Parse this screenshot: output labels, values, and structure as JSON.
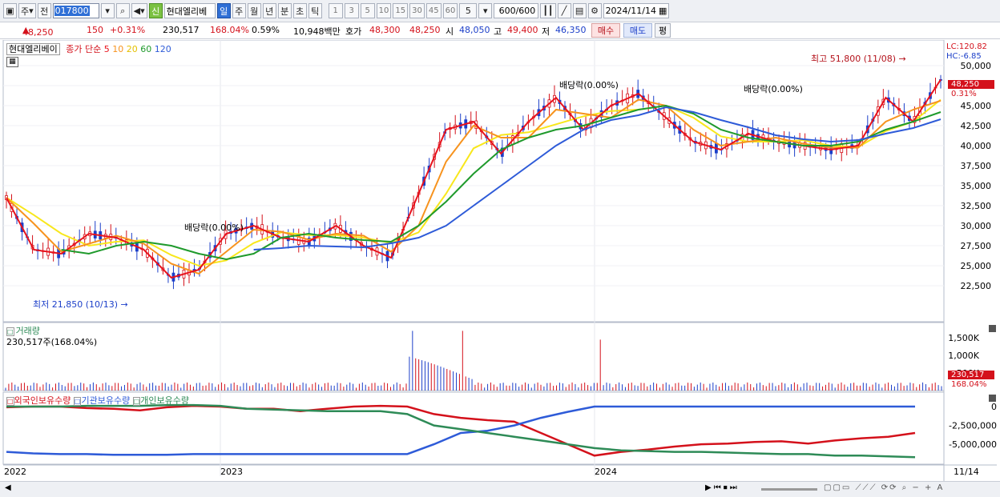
{
  "toolbar": {
    "period_label": "주",
    "prev_label": "전",
    "stock_code": "017800",
    "sin_label": "신",
    "stock_name": "현대엘리베",
    "tabs": [
      "일",
      "주",
      "월",
      "년",
      "분",
      "초",
      "틱"
    ],
    "selected_tab": "일",
    "intervals": [
      "1",
      "3",
      "5",
      "10",
      "15",
      "30",
      "45",
      "60"
    ],
    "interval_value": "5",
    "count": "600/600",
    "date": "2024/11/14"
  },
  "quote": {
    "price": "48,250",
    "change": "150",
    "change_pct": "+0.31%",
    "volume": "230,517",
    "volume_pct": "168.04%",
    "turnover_pct": "0.59%",
    "amount": "10,948백만",
    "ask_label": "호가",
    "ask": "48,300",
    "bid": "48,250",
    "open_label": "시",
    "open": "48,050",
    "high_label": "고",
    "high": "49,400",
    "low_label": "저",
    "low": "46,350",
    "buy_label": "매수",
    "sell_label": "매도",
    "eval_label": "평"
  },
  "price_panel": {
    "name_tag": "현대엘리베이",
    "ma_title": "종가 단순",
    "ma_periods": [
      "5",
      "10",
      "20",
      "60",
      "120"
    ],
    "lc": "LC:120.82",
    "hc": "HC:-6.85",
    "current_tag": "48,250",
    "current_pct": "0.31%",
    "high_note": "최고 51,800 (11/08)",
    "low_note": "최저 21,850 (10/13)",
    "dividend_notes": [
      "배당락(0.00%)",
      "배당락(0.00%)",
      "배당락(0.00%)"
    ]
  },
  "volume_panel": {
    "title": "거래량",
    "value": "230,517주(168.04%)",
    "tag_value": "230,517",
    "tag_pct": "168.04%"
  },
  "holding_panel": {
    "series_labels": [
      "외국인보유수량",
      "기관보유수량",
      "개인보유수량"
    ]
  },
  "x_axis": {
    "labels": [
      "2022",
      "2023",
      "2024"
    ],
    "end_label": "11/14"
  },
  "colors": {
    "up": "#d4111b",
    "down": "#1c3fc9",
    "ma5": "#e8121c",
    "ma10": "#f7931e",
    "ma20": "#f8e71c",
    "ma60": "#1f9a2c",
    "ma120": "#2e5bd8",
    "foreign": "#d4111b",
    "institution": "#2e5bd8",
    "individual": "#2e8b57"
  },
  "chart_data": [
    {
      "type": "line",
      "title": "현대엘리베이",
      "ylim": [
        20000,
        53000
      ],
      "y_ticks": [
        "50,000",
        "47,500",
        "45,000",
        "42,500",
        "40,000",
        "37,500",
        "35,000",
        "32,500",
        "30,000",
        "27,500",
        "25,000",
        "22,500"
      ],
      "x": [
        "2022-01",
        "2022-02",
        "2022-03",
        "2022-04",
        "2022-05",
        "2022-06",
        "2022-07",
        "2022-08",
        "2022-09",
        "2022-10",
        "2022-11",
        "2022-12",
        "2023-01",
        "2023-02",
        "2023-03",
        "2023-04",
        "2023-05",
        "2023-06",
        "2023-07",
        "2023-08",
        "2023-09",
        "2023-10",
        "2023-11",
        "2023-12",
        "2024-01",
        "2024-02",
        "2024-03",
        "2024-04",
        "2024-05",
        "2024-06",
        "2024-07",
        "2024-08",
        "2024-09",
        "2024-10",
        "2024-11"
      ],
      "series": [
        {
          "name": "5",
          "values": [
            33500,
            27000,
            26500,
            29000,
            28500,
            27000,
            23500,
            24500,
            29000,
            30000,
            28500,
            28000,
            30000,
            27500,
            26000,
            34000,
            42000,
            43000,
            39000,
            43000,
            46000,
            42000,
            45000,
            46500,
            43500,
            40500,
            39500,
            41500,
            40500,
            40000,
            39500,
            40000,
            46000,
            43000,
            48250
          ]
        },
        {
          "name": "60",
          "values": [
            null,
            null,
            27000,
            26500,
            27500,
            28000,
            27500,
            26500,
            25800,
            26500,
            28500,
            29000,
            28500,
            28200,
            28000,
            30000,
            33000,
            36500,
            39500,
            41000,
            42000,
            42500,
            43500,
            44500,
            45000,
            44000,
            42000,
            41000,
            40500,
            40000,
            40000,
            40500,
            42000,
            43000,
            44200
          ]
        },
        {
          "name": "120",
          "values": [
            null,
            null,
            null,
            null,
            null,
            null,
            null,
            null,
            null,
            27000,
            27200,
            27500,
            27400,
            27300,
            27800,
            28500,
            30000,
            32500,
            35000,
            37500,
            40000,
            42000,
            43200,
            43800,
            44800,
            44200,
            43200,
            42300,
            41300,
            40800,
            40500,
            40700,
            41500,
            42200,
            43300
          ]
        }
      ]
    },
    {
      "type": "bar",
      "title": "거래량",
      "ylim": [
        0,
        1800000
      ],
      "y_ticks": [
        "1,500K",
        "1,000K",
        "500K"
      ]
    },
    {
      "type": "line",
      "title": "보유수량",
      "ylim": [
        -7000000,
        1000000
      ],
      "y_ticks": [
        "0",
        "-2,500,000",
        "-5,000,000"
      ],
      "series": [
        {
          "name": "외국인보유수량",
          "values": [
            -100000,
            0,
            0,
            -200000,
            -300000,
            -500000,
            -100000,
            100000,
            0,
            -300000,
            -300000,
            -600000,
            -300000,
            0,
            100000,
            0,
            -1000000,
            -1500000,
            -1800000,
            -2000000,
            -3500000,
            -5000000,
            -6500000,
            -6000000,
            -5700000,
            -5300000,
            -5000000,
            -4900000,
            -4700000,
            -4600000,
            -4900000,
            -4500000,
            -4200000,
            -4000000,
            -3500000
          ]
        },
        {
          "name": "기관보유수량",
          "values": [
            -6000000,
            -6200000,
            -6300000,
            -6300000,
            -6400000,
            -6400000,
            -6400000,
            -6300000,
            -6300000,
            -6300000,
            -6300000,
            -6300000,
            -6300000,
            -6300000,
            -6300000,
            -6300000,
            -5000000,
            -3500000,
            -3200000,
            -2500000,
            -1500000,
            -700000,
            0,
            0,
            0,
            0,
            0,
            0,
            0,
            0,
            0,
            0,
            0,
            0,
            0
          ]
        },
        {
          "name": "개인보유수량",
          "values": [
            0,
            0,
            0,
            100000,
            100000,
            100000,
            200000,
            200000,
            100000,
            -300000,
            -400000,
            -500000,
            -600000,
            -600000,
            -600000,
            -1000000,
            -2500000,
            -3000000,
            -3500000,
            -4000000,
            -4500000,
            -5000000,
            -5500000,
            -5800000,
            -5900000,
            -6000000,
            -6000000,
            -6100000,
            -6200000,
            -6300000,
            -6300000,
            -6500000,
            -6500000,
            -6600000,
            -6700000
          ]
        }
      ]
    }
  ]
}
